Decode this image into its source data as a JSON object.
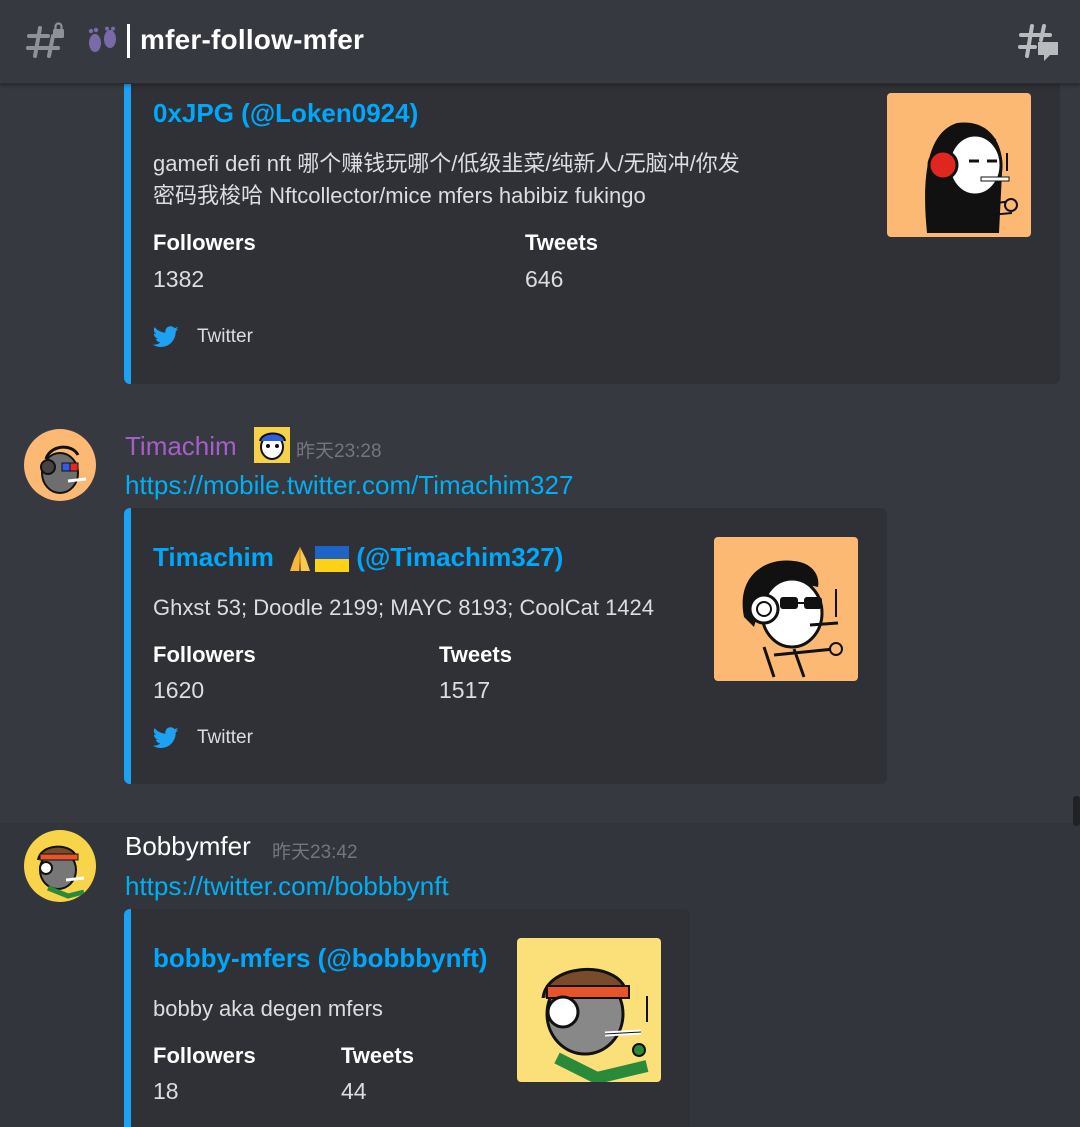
{
  "header": {
    "channel_name": "mfer-follow-mfer"
  },
  "messages": [
    {
      "embed": {
        "title": "0xJPG (@Loken0924)",
        "description_line1": "gamefi defi nft 哪个赚钱玩哪个/低级韭菜/纯新人/无脑冲/你发",
        "description_line2": "密码我梭哈 Nftcollector/mice mfers habibiz fukingo",
        "followers_label": "Followers",
        "followers_value": "1382",
        "tweets_label": "Tweets",
        "tweets_value": "646",
        "footer": "Twitter"
      }
    },
    {
      "username": "Timachim",
      "username_color": "#a65fc9",
      "timestamp": "昨天23:28",
      "link": "https://mobile.twitter.com/Timachim327",
      "embed": {
        "title_name": "Timachim",
        "title_handle": "(@Timachim327)",
        "description": "Ghxst 53; Doodle 2199; MAYC 8193; CoolCat 1424",
        "followers_label": "Followers",
        "followers_value": "1620",
        "tweets_label": "Tweets",
        "tweets_value": "1517",
        "footer": "Twitter"
      }
    },
    {
      "username": "Bobbymfer",
      "username_color": "#ffffff",
      "timestamp": "昨天23:42",
      "link": "https://twitter.com/bobbbynft",
      "embed": {
        "title": "bobby-mfers (@bobbbynft)",
        "description": "bobby aka degen mfers",
        "followers_label": "Followers",
        "followers_value": "18",
        "tweets_label": "Tweets",
        "tweets_value": "44"
      }
    }
  ],
  "colors": {
    "background": "#36393f",
    "embed_bg": "#2f3136",
    "twitter_blue": "#1da1f2",
    "link_blue": "#00aff4",
    "title_blue": "#00a8fc"
  },
  "icons": [
    "hash-lock-icon",
    "footprints-icon",
    "threads-icon",
    "twitter-bird-icon",
    "folded-hands-emoji",
    "ukraine-flag-emoji"
  ]
}
